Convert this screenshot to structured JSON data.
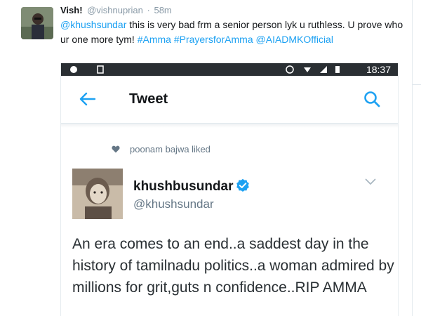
{
  "outer_tweet": {
    "name": "Vish!",
    "handle": "@vishnuprian",
    "separator": "·",
    "time": "58m",
    "mention_1": "@khushsundar",
    "text_1": " this is very bad frm a senior person lyk u ruthless. U prove who ur one more tym! ",
    "hashtag_1": "#Amma",
    "hashtag_2": "#PrayersforAmma",
    "mention_2": "@AIADMKOfficial"
  },
  "embedded_screenshot": {
    "status_time": "18:37",
    "app_title": "Tweet",
    "liked_by": "poonam bajwa liked",
    "inner_tweet": {
      "name": "khushbusundar",
      "handle": "@khushsundar",
      "text": "An era comes to an end..a saddest day in the history of tamilnadu politics..a woman admired by millions for grit,guts n confidence..RIP AMMA"
    }
  },
  "colors": {
    "link": "#1da1f2",
    "verified": "#1da1f2",
    "status_bar": "#2a2f33",
    "secondary_text": "#657786"
  },
  "icons": [
    "back-arrow-icon",
    "search-icon",
    "heart-icon",
    "verified-badge-icon",
    "chevron-down-icon",
    "signal-icon",
    "wifi-icon",
    "battery-icon",
    "alarm-icon",
    "notification-icon"
  ]
}
